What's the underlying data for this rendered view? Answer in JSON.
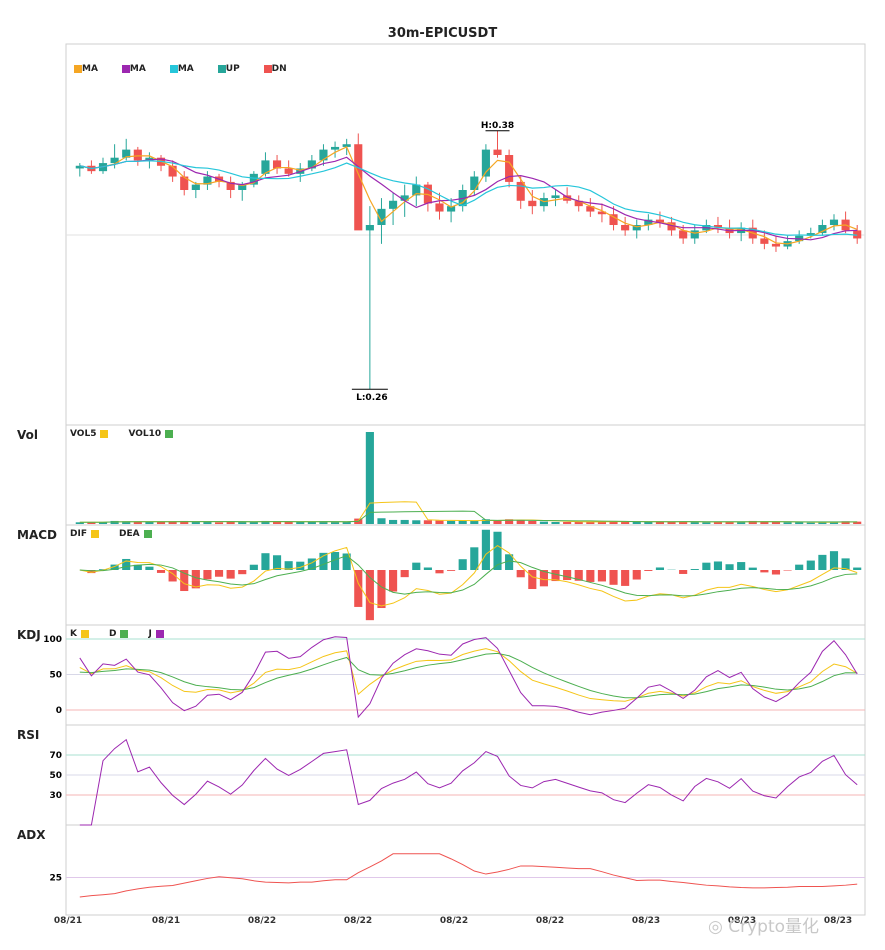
{
  "chart_data": {
    "type": "candlestick",
    "title": "30m-EPICUSDT",
    "x_tick_labels": [
      "08/21",
      "08/21",
      "08/22",
      "08/22",
      "08/22",
      "08/22",
      "08/23",
      "08/23",
      "08/23"
    ],
    "price_panel": {
      "legend": [
        "MA",
        "MA",
        "MA",
        "UP",
        "DN"
      ],
      "annotations": {
        "high": "H:0.38",
        "low": "L:0.26"
      },
      "colors": {
        "up": "#26a69a",
        "down": "#ef5350",
        "ma1": "#f5a623",
        "ma2": "#9c27b0",
        "ma3": "#26c6da"
      },
      "ylim": [
        0.255,
        0.385
      ],
      "candles": [
        [
          0.341,
          0.343,
          0.338,
          0.342
        ],
        [
          0.342,
          0.344,
          0.339,
          0.34
        ],
        [
          0.34,
          0.345,
          0.339,
          0.343
        ],
        [
          0.343,
          0.35,
          0.341,
          0.345
        ],
        [
          0.345,
          0.352,
          0.344,
          0.348
        ],
        [
          0.348,
          0.349,
          0.342,
          0.344
        ],
        [
          0.344,
          0.347,
          0.341,
          0.345
        ],
        [
          0.345,
          0.346,
          0.34,
          0.342
        ],
        [
          0.342,
          0.344,
          0.336,
          0.338
        ],
        [
          0.338,
          0.34,
          0.331,
          0.333
        ],
        [
          0.333,
          0.336,
          0.33,
          0.335
        ],
        [
          0.335,
          0.34,
          0.333,
          0.338
        ],
        [
          0.338,
          0.339,
          0.334,
          0.336
        ],
        [
          0.336,
          0.338,
          0.33,
          0.333
        ],
        [
          0.333,
          0.336,
          0.329,
          0.335
        ],
        [
          0.335,
          0.34,
          0.334,
          0.339
        ],
        [
          0.339,
          0.347,
          0.338,
          0.344
        ],
        [
          0.344,
          0.346,
          0.339,
          0.341
        ],
        [
          0.341,
          0.344,
          0.338,
          0.339
        ],
        [
          0.339,
          0.343,
          0.336,
          0.341
        ],
        [
          0.341,
          0.346,
          0.34,
          0.344
        ],
        [
          0.344,
          0.35,
          0.342,
          0.348
        ],
        [
          0.348,
          0.351,
          0.345,
          0.349
        ],
        [
          0.349,
          0.352,
          0.346,
          0.35
        ],
        [
          0.35,
          0.354,
          0.338,
          0.318
        ],
        [
          0.318,
          0.327,
          0.259,
          0.32
        ],
        [
          0.32,
          0.33,
          0.313,
          0.326
        ],
        [
          0.326,
          0.332,
          0.32,
          0.329
        ],
        [
          0.329,
          0.335,
          0.323,
          0.331
        ],
        [
          0.331,
          0.338,
          0.327,
          0.335
        ],
        [
          0.335,
          0.336,
          0.325,
          0.328
        ],
        [
          0.328,
          0.332,
          0.322,
          0.325
        ],
        [
          0.325,
          0.33,
          0.321,
          0.327
        ],
        [
          0.327,
          0.335,
          0.325,
          0.333
        ],
        [
          0.333,
          0.34,
          0.331,
          0.338
        ],
        [
          0.338,
          0.35,
          0.336,
          0.348
        ],
        [
          0.348,
          0.355,
          0.345,
          0.346
        ],
        [
          0.346,
          0.348,
          0.334,
          0.336
        ],
        [
          0.336,
          0.338,
          0.326,
          0.329
        ],
        [
          0.329,
          0.333,
          0.324,
          0.327
        ],
        [
          0.327,
          0.332,
          0.325,
          0.33
        ],
        [
          0.33,
          0.333,
          0.327,
          0.331
        ],
        [
          0.331,
          0.334,
          0.328,
          0.329
        ],
        [
          0.329,
          0.331,
          0.325,
          0.327
        ],
        [
          0.327,
          0.33,
          0.323,
          0.325
        ],
        [
          0.325,
          0.328,
          0.321,
          0.324
        ],
        [
          0.324,
          0.327,
          0.318,
          0.32
        ],
        [
          0.32,
          0.323,
          0.316,
          0.318
        ],
        [
          0.318,
          0.322,
          0.315,
          0.32
        ],
        [
          0.32,
          0.324,
          0.318,
          0.322
        ],
        [
          0.322,
          0.325,
          0.319,
          0.321
        ],
        [
          0.321,
          0.323,
          0.316,
          0.318
        ],
        [
          0.318,
          0.32,
          0.313,
          0.315
        ],
        [
          0.315,
          0.32,
          0.313,
          0.318
        ],
        [
          0.318,
          0.322,
          0.317,
          0.32
        ],
        [
          0.32,
          0.323,
          0.317,
          0.319
        ],
        [
          0.319,
          0.322,
          0.315,
          0.317
        ],
        [
          0.317,
          0.321,
          0.314,
          0.319
        ],
        [
          0.319,
          0.322,
          0.313,
          0.315
        ],
        [
          0.315,
          0.318,
          0.311,
          0.313
        ],
        [
          0.313,
          0.316,
          0.31,
          0.312
        ],
        [
          0.312,
          0.316,
          0.311,
          0.314
        ],
        [
          0.314,
          0.318,
          0.313,
          0.316
        ],
        [
          0.316,
          0.319,
          0.315,
          0.317
        ],
        [
          0.317,
          0.322,
          0.316,
          0.32
        ],
        [
          0.32,
          0.324,
          0.318,
          0.322
        ],
        [
          0.322,
          0.325,
          0.317,
          0.318
        ],
        [
          0.318,
          0.32,
          0.313,
          0.315
        ]
      ]
    },
    "volume_panel": {
      "label": "Vol",
      "legend": [
        "VOL5",
        "VOL10"
      ],
      "colors": {
        "vol5": "#f5c518",
        "vol10": "#4caf50"
      }
    },
    "macd_panel": {
      "label": "MACD",
      "legend": [
        "DIF",
        "DEA"
      ],
      "colors": {
        "dif": "#f5c518",
        "dea": "#4caf50"
      }
    },
    "kdj_panel": {
      "label": "KDJ",
      "legend": [
        "K",
        "D",
        "J"
      ],
      "ticks": [
        "100",
        "50",
        "0"
      ],
      "colors": {
        "k": "#f5c518",
        "d": "#4caf50",
        "j": "#9c27b0"
      }
    },
    "rsi_panel": {
      "label": "RSI",
      "ticks": [
        "70",
        "50",
        "30"
      ],
      "color": "#9c27b0"
    },
    "adx_panel": {
      "label": "ADX",
      "ticks": [
        "25"
      ],
      "color": "#ef5350"
    }
  },
  "watermark": "◎ Crypto量化"
}
